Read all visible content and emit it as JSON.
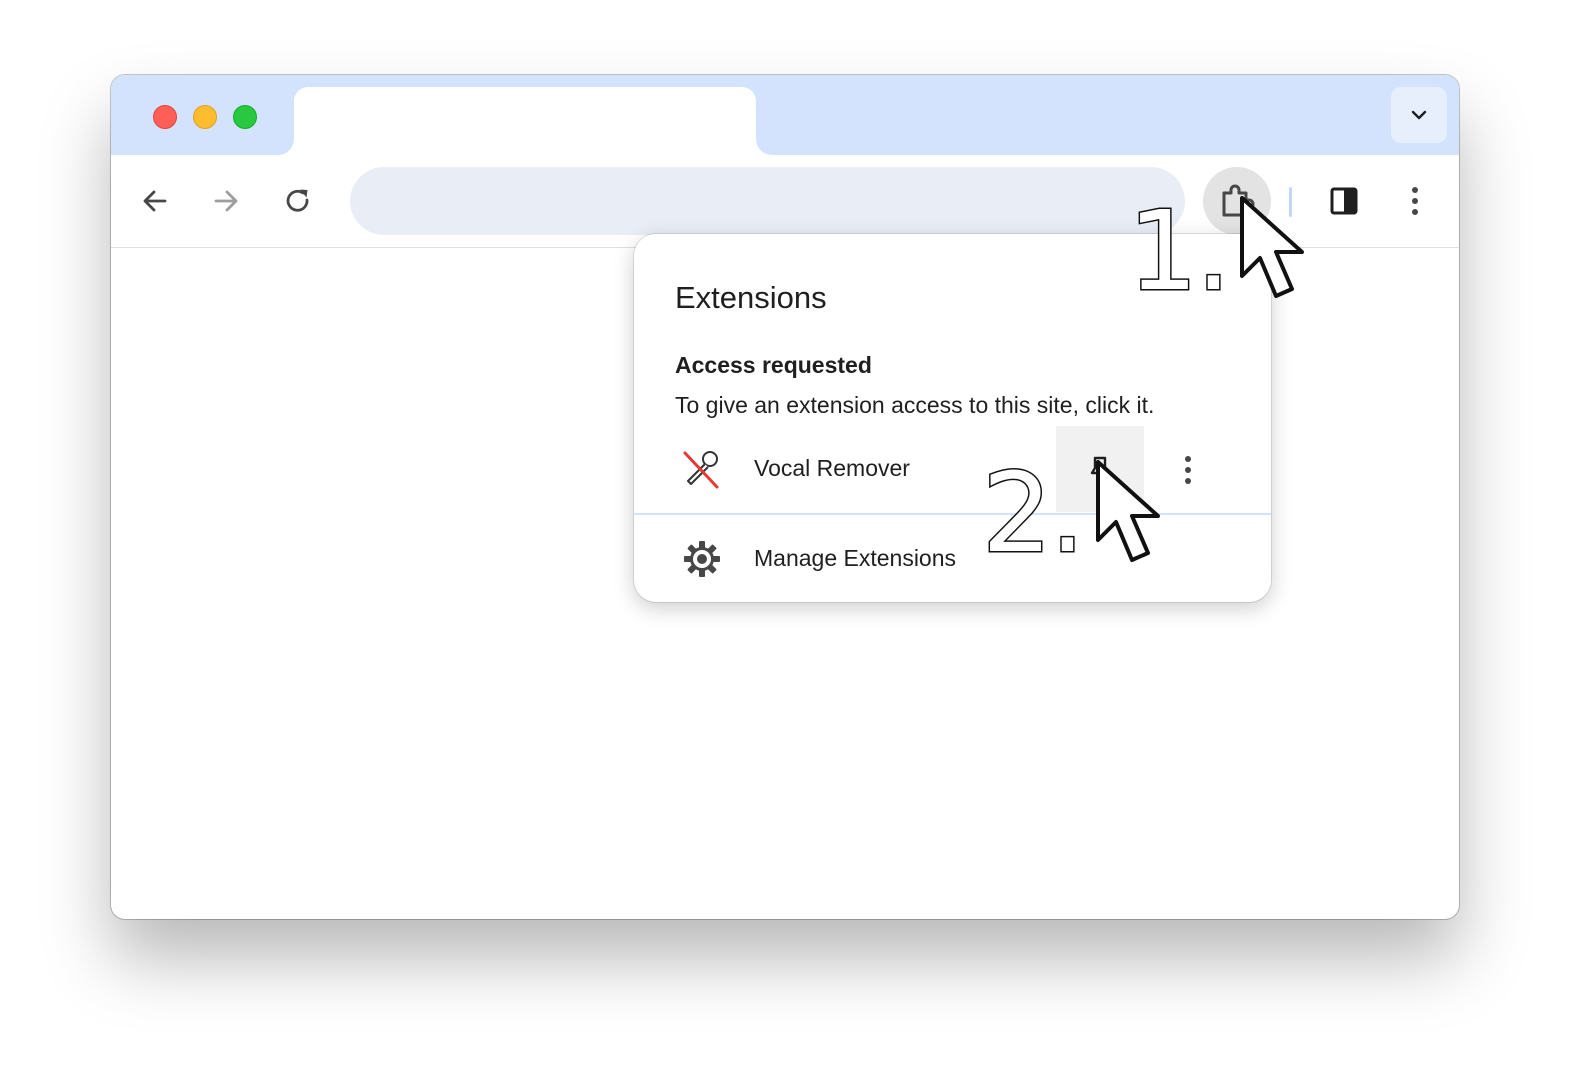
{
  "titlebar": {
    "traffic_lights": [
      "close",
      "minimize",
      "zoom"
    ],
    "tab_search_icon": "chevron-down-icon"
  },
  "toolbar": {
    "back_icon": "arrow-left-icon",
    "forward_icon": "arrow-right-icon",
    "reload_icon": "reload-icon",
    "address_value": "",
    "extensions_icon": "puzzle-icon",
    "side_panel_icon": "side-panel-icon",
    "menu_icon": "kebab-menu-icon"
  },
  "popup": {
    "title": "Extensions",
    "section_heading": "Access requested",
    "section_description": "To give an extension access to this site, click it.",
    "extensions": [
      {
        "name": "Vocal Remover",
        "icon": "microphone-crossed-icon",
        "pin_icon": "pin-icon",
        "more_icon": "kebab-menu-icon"
      }
    ],
    "manage_label": "Manage Extensions",
    "manage_icon": "gear-icon"
  },
  "annotations": {
    "step_1": "1.",
    "step_2": "2."
  },
  "colors": {
    "titlebar": "#d3e3fd",
    "omnibox": "#e9eef6",
    "divider": "#d3e3fd"
  }
}
